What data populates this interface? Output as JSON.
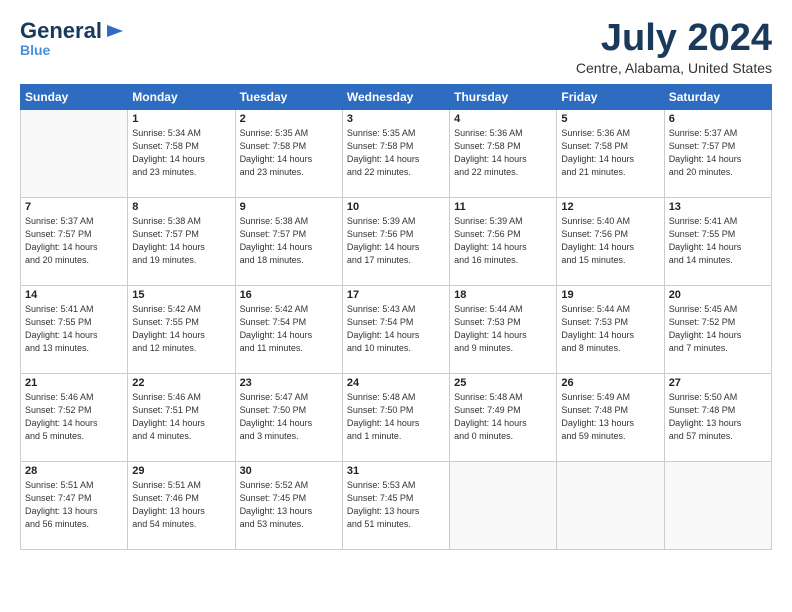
{
  "logo": {
    "line1": "General",
    "line2": "Blue"
  },
  "title": "July 2024",
  "subtitle": "Centre, Alabama, United States",
  "days_of_week": [
    "Sunday",
    "Monday",
    "Tuesday",
    "Wednesday",
    "Thursday",
    "Friday",
    "Saturday"
  ],
  "weeks": [
    [
      {
        "num": "",
        "info": ""
      },
      {
        "num": "1",
        "info": "Sunrise: 5:34 AM\nSunset: 7:58 PM\nDaylight: 14 hours\nand 23 minutes."
      },
      {
        "num": "2",
        "info": "Sunrise: 5:35 AM\nSunset: 7:58 PM\nDaylight: 14 hours\nand 23 minutes."
      },
      {
        "num": "3",
        "info": "Sunrise: 5:35 AM\nSunset: 7:58 PM\nDaylight: 14 hours\nand 22 minutes."
      },
      {
        "num": "4",
        "info": "Sunrise: 5:36 AM\nSunset: 7:58 PM\nDaylight: 14 hours\nand 22 minutes."
      },
      {
        "num": "5",
        "info": "Sunrise: 5:36 AM\nSunset: 7:58 PM\nDaylight: 14 hours\nand 21 minutes."
      },
      {
        "num": "6",
        "info": "Sunrise: 5:37 AM\nSunset: 7:57 PM\nDaylight: 14 hours\nand 20 minutes."
      }
    ],
    [
      {
        "num": "7",
        "info": "Sunrise: 5:37 AM\nSunset: 7:57 PM\nDaylight: 14 hours\nand 20 minutes."
      },
      {
        "num": "8",
        "info": "Sunrise: 5:38 AM\nSunset: 7:57 PM\nDaylight: 14 hours\nand 19 minutes."
      },
      {
        "num": "9",
        "info": "Sunrise: 5:38 AM\nSunset: 7:57 PM\nDaylight: 14 hours\nand 18 minutes."
      },
      {
        "num": "10",
        "info": "Sunrise: 5:39 AM\nSunset: 7:56 PM\nDaylight: 14 hours\nand 17 minutes."
      },
      {
        "num": "11",
        "info": "Sunrise: 5:39 AM\nSunset: 7:56 PM\nDaylight: 14 hours\nand 16 minutes."
      },
      {
        "num": "12",
        "info": "Sunrise: 5:40 AM\nSunset: 7:56 PM\nDaylight: 14 hours\nand 15 minutes."
      },
      {
        "num": "13",
        "info": "Sunrise: 5:41 AM\nSunset: 7:55 PM\nDaylight: 14 hours\nand 14 minutes."
      }
    ],
    [
      {
        "num": "14",
        "info": "Sunrise: 5:41 AM\nSunset: 7:55 PM\nDaylight: 14 hours\nand 13 minutes."
      },
      {
        "num": "15",
        "info": "Sunrise: 5:42 AM\nSunset: 7:55 PM\nDaylight: 14 hours\nand 12 minutes."
      },
      {
        "num": "16",
        "info": "Sunrise: 5:42 AM\nSunset: 7:54 PM\nDaylight: 14 hours\nand 11 minutes."
      },
      {
        "num": "17",
        "info": "Sunrise: 5:43 AM\nSunset: 7:54 PM\nDaylight: 14 hours\nand 10 minutes."
      },
      {
        "num": "18",
        "info": "Sunrise: 5:44 AM\nSunset: 7:53 PM\nDaylight: 14 hours\nand 9 minutes."
      },
      {
        "num": "19",
        "info": "Sunrise: 5:44 AM\nSunset: 7:53 PM\nDaylight: 14 hours\nand 8 minutes."
      },
      {
        "num": "20",
        "info": "Sunrise: 5:45 AM\nSunset: 7:52 PM\nDaylight: 14 hours\nand 7 minutes."
      }
    ],
    [
      {
        "num": "21",
        "info": "Sunrise: 5:46 AM\nSunset: 7:52 PM\nDaylight: 14 hours\nand 5 minutes."
      },
      {
        "num": "22",
        "info": "Sunrise: 5:46 AM\nSunset: 7:51 PM\nDaylight: 14 hours\nand 4 minutes."
      },
      {
        "num": "23",
        "info": "Sunrise: 5:47 AM\nSunset: 7:50 PM\nDaylight: 14 hours\nand 3 minutes."
      },
      {
        "num": "24",
        "info": "Sunrise: 5:48 AM\nSunset: 7:50 PM\nDaylight: 14 hours\nand 1 minute."
      },
      {
        "num": "25",
        "info": "Sunrise: 5:48 AM\nSunset: 7:49 PM\nDaylight: 14 hours\nand 0 minutes."
      },
      {
        "num": "26",
        "info": "Sunrise: 5:49 AM\nSunset: 7:48 PM\nDaylight: 13 hours\nand 59 minutes."
      },
      {
        "num": "27",
        "info": "Sunrise: 5:50 AM\nSunset: 7:48 PM\nDaylight: 13 hours\nand 57 minutes."
      }
    ],
    [
      {
        "num": "28",
        "info": "Sunrise: 5:51 AM\nSunset: 7:47 PM\nDaylight: 13 hours\nand 56 minutes."
      },
      {
        "num": "29",
        "info": "Sunrise: 5:51 AM\nSunset: 7:46 PM\nDaylight: 13 hours\nand 54 minutes."
      },
      {
        "num": "30",
        "info": "Sunrise: 5:52 AM\nSunset: 7:45 PM\nDaylight: 13 hours\nand 53 minutes."
      },
      {
        "num": "31",
        "info": "Sunrise: 5:53 AM\nSunset: 7:45 PM\nDaylight: 13 hours\nand 51 minutes."
      },
      {
        "num": "",
        "info": ""
      },
      {
        "num": "",
        "info": ""
      },
      {
        "num": "",
        "info": ""
      }
    ]
  ]
}
